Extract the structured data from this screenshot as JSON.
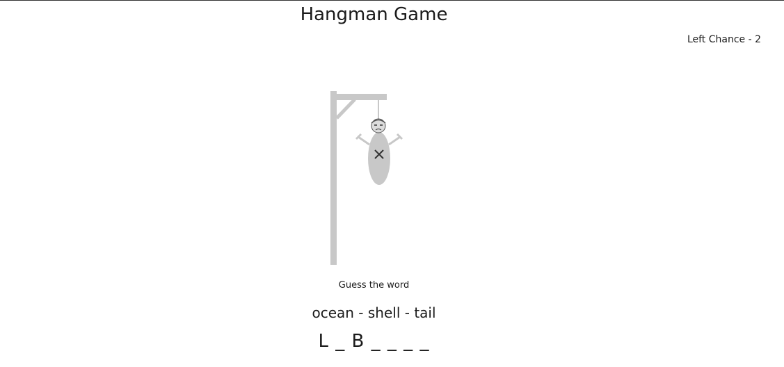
{
  "title": "Hangman Game",
  "chances": "Left Chance - 2",
  "prompt": "Guess the word",
  "hint": "ocean - shell - tail",
  "word_display": "L _ B _ _ _ _",
  "colors": {
    "gallows": "#c8c8c8",
    "figure": "#c8c8c8",
    "ink": "#333333"
  },
  "icons": {
    "gallows": "gallows-icon",
    "figure": "hanged-figure-icon"
  }
}
